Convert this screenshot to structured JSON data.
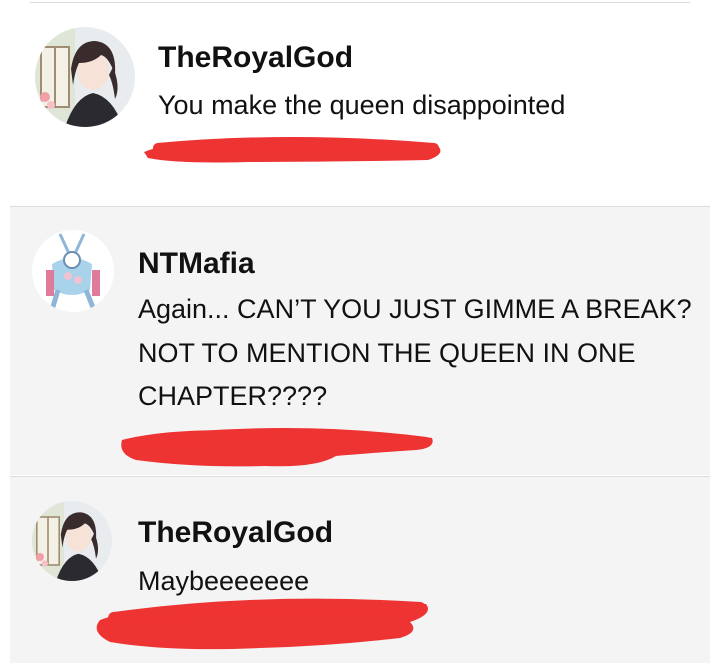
{
  "comments": [
    {
      "username": "TheRoyalGod",
      "avatar_icon": "anime-boy-avatar-icon",
      "lines": [
        "You make the queen disappointed"
      ]
    },
    {
      "username": "NTMafia",
      "avatar_icon": "stand-character-avatar-icon",
      "lines": [
        "Again... CAN’T YOU JUST GIMME A BREAK?",
        "NOT TO MENTION THE QUEEN IN ONE",
        "CHAPTER????"
      ]
    },
    {
      "username": "TheRoyalGod",
      "avatar_icon": "anime-boy-avatar-icon",
      "lines": [
        "Maybeeeeeee"
      ]
    }
  ],
  "colors": {
    "redaction": "#ee3333",
    "card_grey": "#f4f4f4",
    "card_white": "#ffffff",
    "divider": "#dcdcdc"
  }
}
